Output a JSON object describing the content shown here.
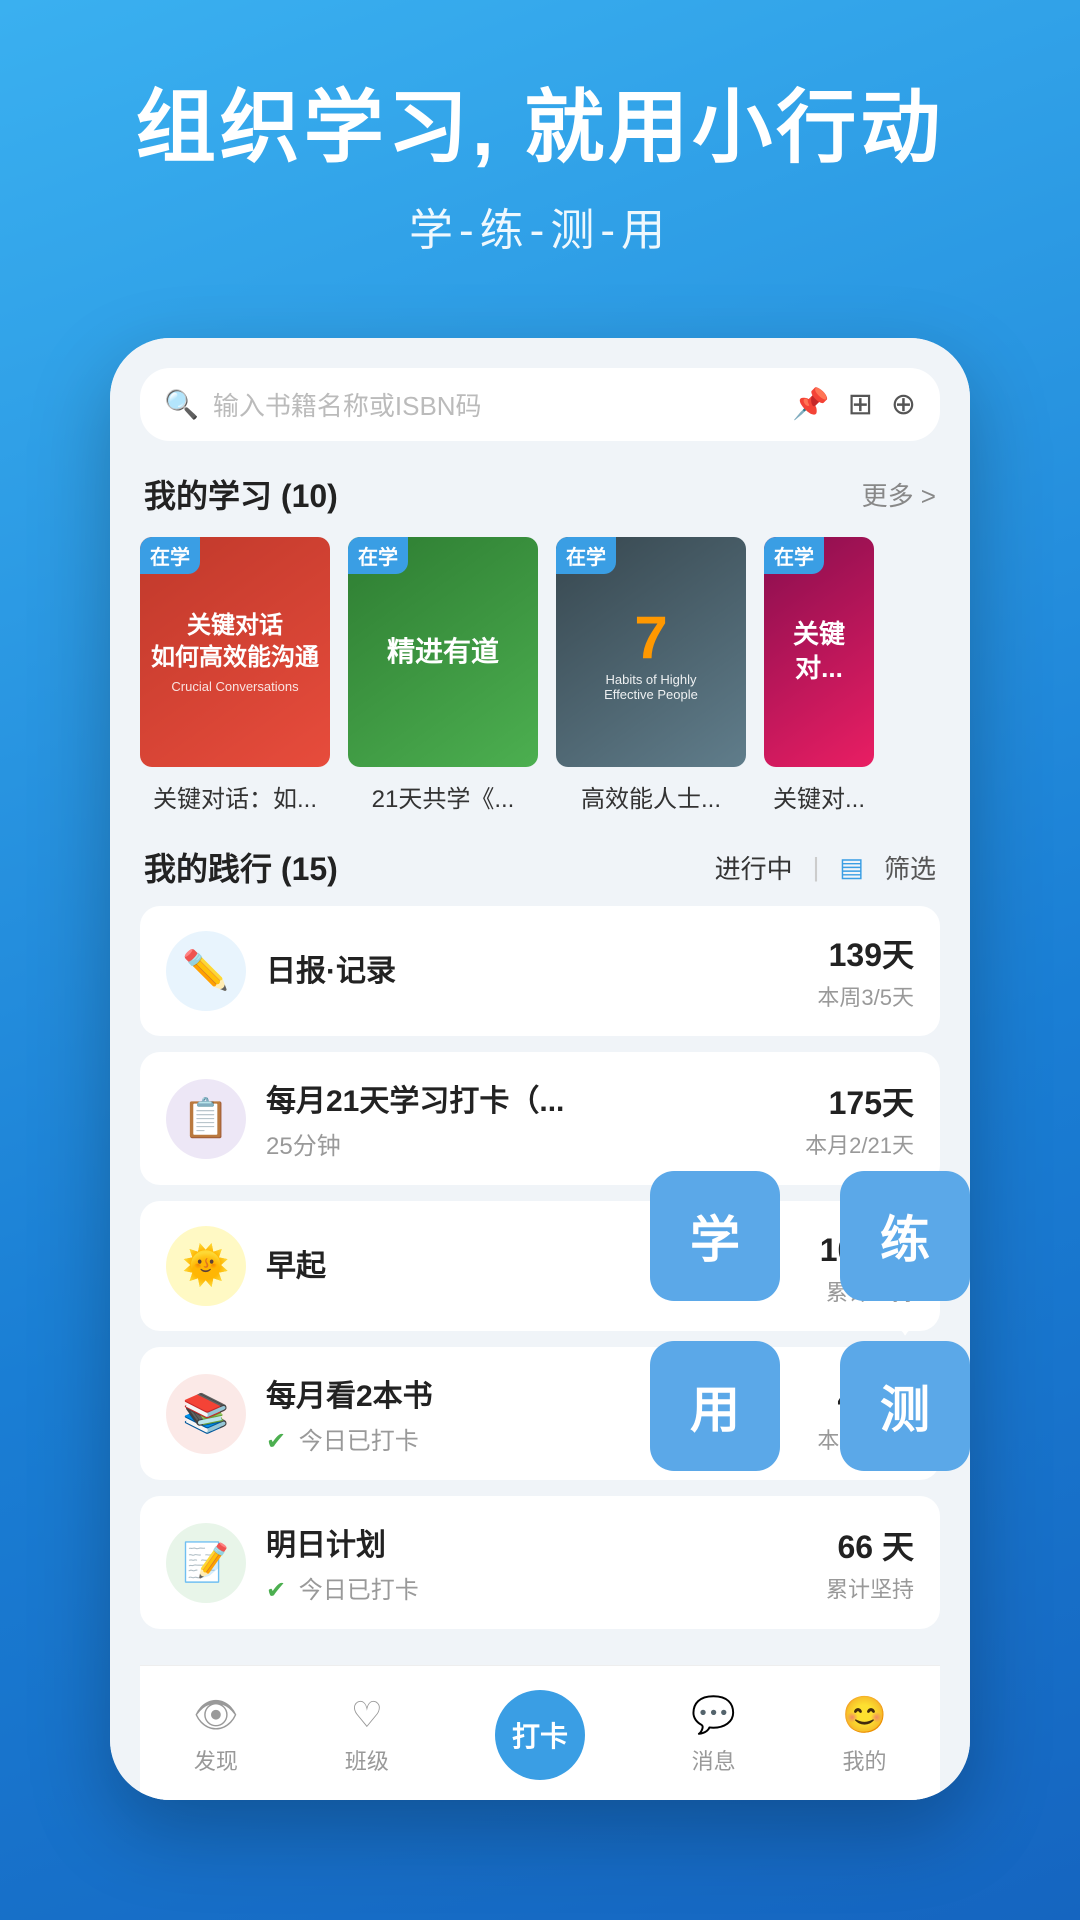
{
  "hero": {
    "title": "组织学习, 就用小行动",
    "subtitle": "学-练-测-用"
  },
  "search": {
    "placeholder": "输入书籍名称或ISBN码"
  },
  "my_learning": {
    "section_title": "我的学习",
    "count": "(10)",
    "more_label": "更多 >",
    "books": [
      {
        "title_short": "关键对话：如...",
        "badge": "在学",
        "cover_type": "crucial"
      },
      {
        "title_short": "21天共学《...",
        "badge": "在学",
        "cover_type": "21days"
      },
      {
        "title_short": "高效能人士...",
        "badge": "在学",
        "cover_type": "7habits"
      },
      {
        "title_short": "关键对...",
        "badge": "在学",
        "cover_type": "4th"
      }
    ]
  },
  "my_practice": {
    "section_title": "我的践行",
    "count": "(15)",
    "filter_status": "进行中",
    "filter_label": "筛选",
    "items": [
      {
        "name": "日报·记录",
        "sub": "",
        "has_check": false,
        "days": "139天",
        "stat_sub": "本周3/5天",
        "icon": "✏️",
        "icon_class": "practice-icon-1"
      },
      {
        "name": "每月21天学习打卡（...",
        "sub": "25分钟",
        "has_check": false,
        "days": "175天",
        "stat_sub": "本月2/21天",
        "icon": "📋",
        "icon_class": "practice-icon-2"
      },
      {
        "name": "早起",
        "sub": "",
        "has_check": false,
        "days": "103 天",
        "stat_sub": "累计坚持",
        "icon": "🌞",
        "icon_class": "practice-icon-3"
      },
      {
        "name": "每月看2本书",
        "sub": "今日已打卡",
        "has_check": true,
        "days": "46 次",
        "stat_sub": "本月1/2次",
        "icon": "📚",
        "icon_class": "practice-icon-4"
      },
      {
        "name": "明日计划",
        "sub": "今日已打卡",
        "has_check": true,
        "days": "66 天",
        "stat_sub": "累计坚持",
        "icon": "📝",
        "icon_class": "practice-icon-5"
      }
    ]
  },
  "slxc": {
    "learn": "学",
    "practice": "练",
    "use": "用",
    "test": "测"
  },
  "bottom_nav": {
    "items": [
      {
        "label": "发现",
        "icon": "👁",
        "active": false
      },
      {
        "label": "班级",
        "icon": "♡",
        "active": false
      },
      {
        "label": "打卡",
        "icon": "打卡",
        "active": true,
        "center": true
      },
      {
        "label": "消息",
        "icon": "💬",
        "active": false
      },
      {
        "label": "我的",
        "icon": "😊",
        "active": false
      }
    ]
  }
}
